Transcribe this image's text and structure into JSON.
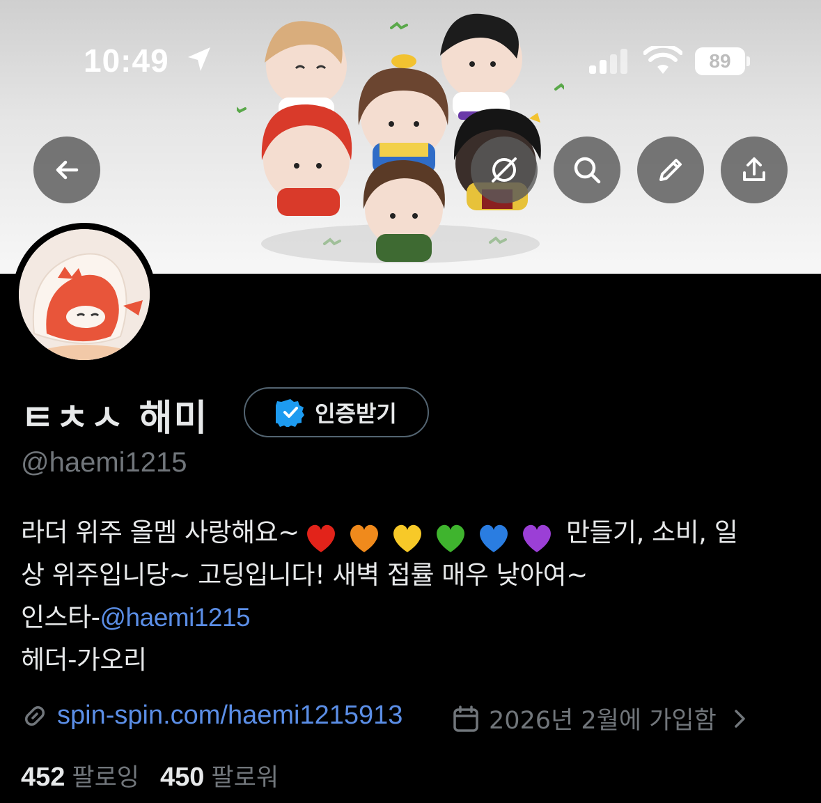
{
  "status_bar": {
    "time": "10:49",
    "battery": "89",
    "icons": [
      "location-arrow-icon",
      "cellular-signal-icon",
      "wifi-icon",
      "battery-icon"
    ]
  },
  "header_actions": {
    "back": "arrow-left-icon",
    "grok": "grok-icon",
    "search": "search-icon",
    "edit": "pencil-icon",
    "share": "share-icon"
  },
  "profile": {
    "display_name": "ㅌㅊㅅ 해미",
    "verify_button": "인증받기",
    "handle": "@haemi1215"
  },
  "bio": {
    "line1_text": "라더 위주 올멤 사랑해요~",
    "hearts": [
      "red",
      "orange",
      "yellow",
      "green",
      "blue",
      "purple"
    ],
    "line1_suffix": "만들기, 소비, 일",
    "line2": "상 위주입니당~ 고딩입니다! 새벽 접률 매우 낮아여~",
    "line3_prefix": "인스타-",
    "line3_mention": "@haemi1215",
    "line4": "헤더-가오리"
  },
  "meta": {
    "website": "spin-spin.com/haemi1215913",
    "joined": "2026년 2월에 가입함"
  },
  "counts": {
    "following_count": "452",
    "following_label": "팔로잉",
    "followers_count": "450",
    "followers_label": "팔로워"
  },
  "colors": {
    "background": "#000000",
    "text": "#e7e9ea",
    "muted": "#71767b",
    "link": "#5b8ee6",
    "verified": "#1d9bf0"
  }
}
